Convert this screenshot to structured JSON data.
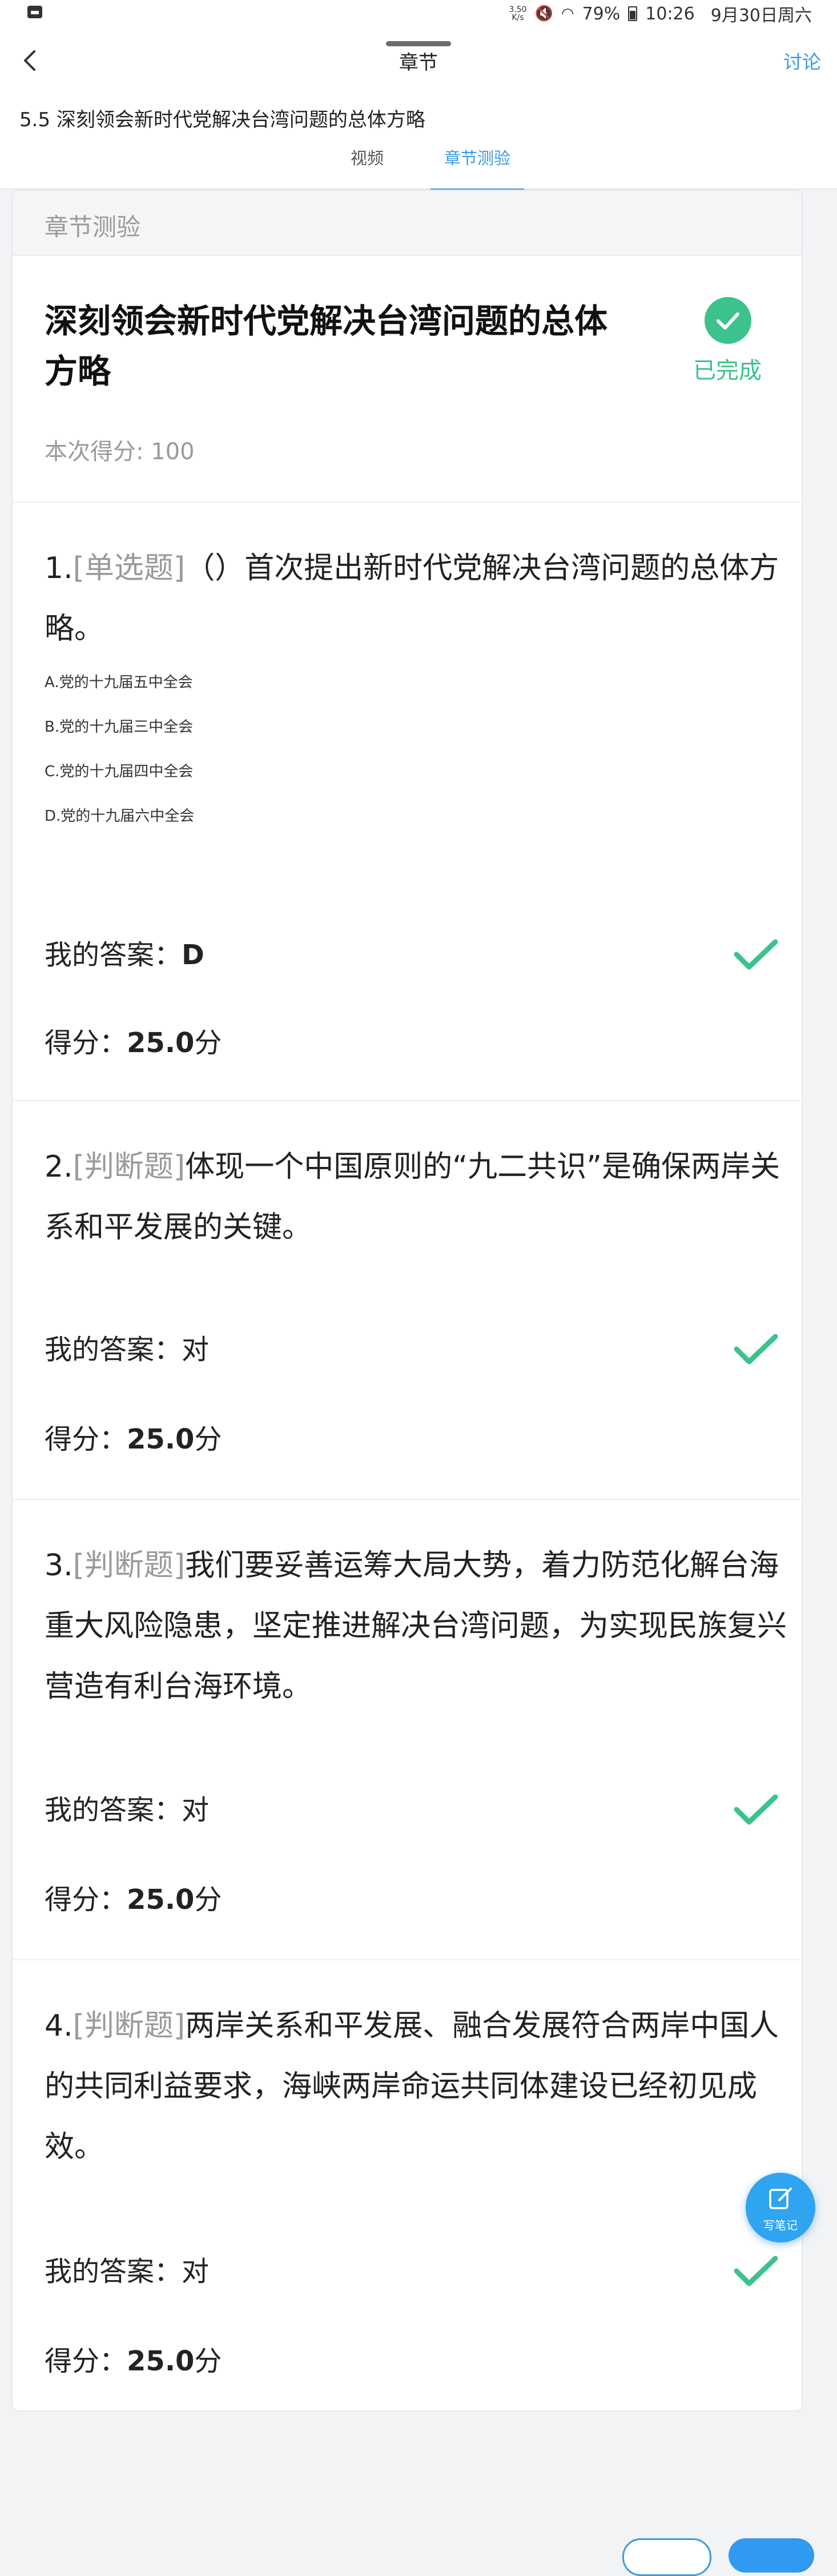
{
  "status_bar": {
    "net_speed_value": "3.50",
    "net_speed_unit": "K/s",
    "battery": "79%",
    "time": "10:26",
    "date": "9月30日周六"
  },
  "nav": {
    "title": "章节",
    "discuss": "讨论"
  },
  "chapter": {
    "title": "5.5 深刻领会新时代党解决台湾问题的总体方略",
    "tabs": [
      {
        "label": "视频",
        "active": false
      },
      {
        "label": "章节测验",
        "active": true
      }
    ]
  },
  "quiz": {
    "section_label": "章节测验",
    "title": "深刻领会新时代党解决台湾问题的总体方略",
    "status": "已完成",
    "score_label": "本次得分: 100",
    "answer_label": "我的答案：",
    "score_prefix": "得分：",
    "questions": [
      {
        "number": "1.",
        "type": "[单选题]",
        "text": "（）首次提出新时代党解决台湾问题的总体方略。",
        "options": [
          "A.党的十九届五中全会",
          "B.党的十九届三中全会",
          "C.党的十九届四中全会",
          "D.党的十九届六中全会"
        ],
        "answer": "D",
        "score": "25.0",
        "score_unit": "分",
        "correct": true
      },
      {
        "number": "2.",
        "type": "[判断题]",
        "text": "体现一个中国原则的“九二共识”是确保两岸关系和平发展的关键。",
        "answer": "对",
        "score": "25.0",
        "score_unit": "分",
        "correct": true
      },
      {
        "number": "3.",
        "type": "[判断题]",
        "text": "我们要妥善运筹大局大势，着力防范化解台海重大风险隐患，坚定推进解决台湾问题，为实现民族复兴营造有利台海环境。",
        "answer": "对",
        "score": "25.0",
        "score_unit": "分",
        "correct": true
      },
      {
        "number": "4.",
        "type": "[判断题]",
        "text": "两岸关系和平发展、融合发展符合两岸中国人的共同利益要求，海峡两岸命运共同体建设已经初见成效。",
        "answer": "对",
        "score": "25.0",
        "score_unit": "分",
        "correct": true
      }
    ]
  },
  "floating": {
    "note_label": "写笔记"
  },
  "colors": {
    "accent": "#3a9ae0",
    "success": "#3cc28c",
    "muted": "#9a9a9a"
  }
}
